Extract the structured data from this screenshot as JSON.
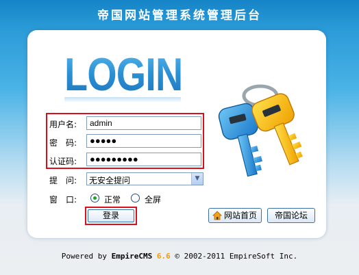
{
  "header": {
    "title": "帝国网站管理系统管理后台"
  },
  "logo": {
    "text": "LOGIN"
  },
  "form": {
    "username": {
      "label": "用户名:",
      "value": "admin"
    },
    "password": {
      "label": "密　码:",
      "value": "●●●●●"
    },
    "captcha": {
      "label": "认证码:",
      "value": "●●●●●●●●●"
    },
    "question": {
      "label": "提　问:",
      "selected": "无安全提问"
    },
    "window": {
      "label": "窗　口:",
      "options": [
        {
          "label": "正常",
          "checked": true
        },
        {
          "label": "全屏",
          "checked": false
        }
      ]
    },
    "login_button": "登录"
  },
  "links": {
    "home": "网站首页",
    "forum": "帝国论坛"
  },
  "footer": {
    "prefix": "Powered by ",
    "product": "EmpireCMS",
    "version": "6.6",
    "copyright": " © 2002-2011 EmpireSoft Inc."
  },
  "icons": [
    "keys-icon",
    "house-icon"
  ],
  "colors": {
    "header_blue": "#1584c7",
    "highlight_red": "#d8101e",
    "version_orange": "#f09c00"
  }
}
